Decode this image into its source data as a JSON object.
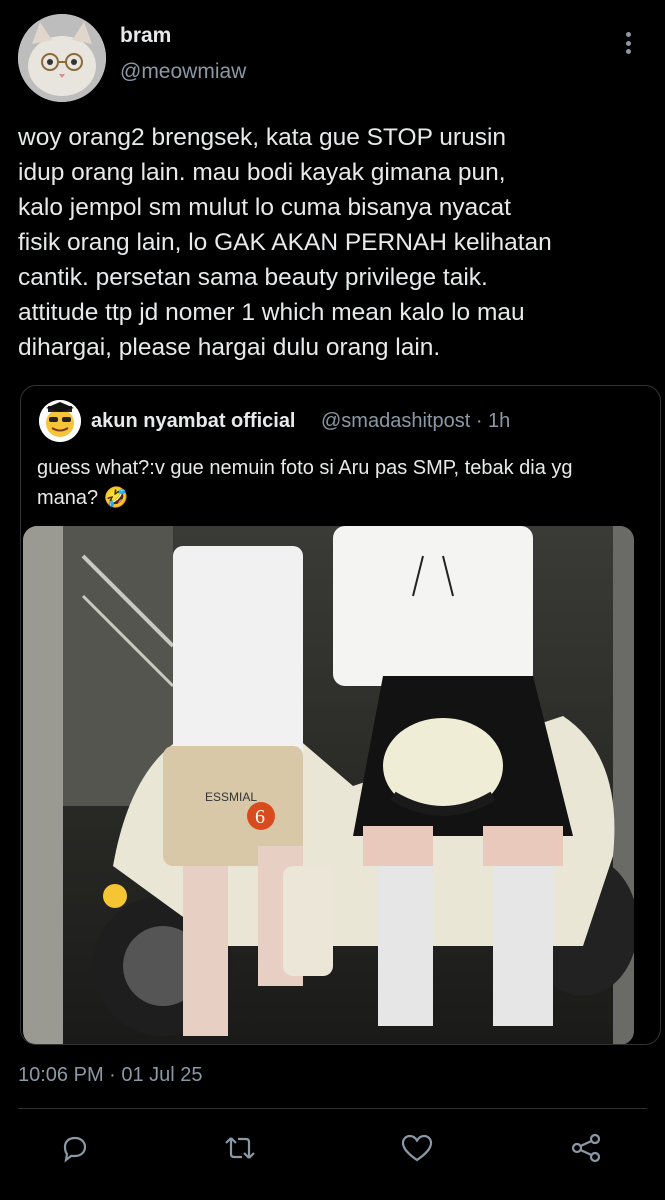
{
  "author": {
    "name": "bram",
    "handle": "@meowmiaw"
  },
  "tweet": {
    "text": "woy orang2 brengsek, kata gue STOP urusin\nidup orang lain. mau bodi kayak gimana pun,\nkalo jempol sm mulut lo cuma bisanya nyacat\nfisik orang lain, lo GAK AKAN PERNAH kelihatan\ncantik. persetan sama beauty privilege taik.\nattitude ttp jd nomer 1 which mean kalo lo mau\ndihargai, please hargai dulu orang lain.",
    "timestamp": "10:06 PM · 01 Jul 25"
  },
  "quoted": {
    "name": "akun nyambat official",
    "meta": "@smadashitpost · 1h",
    "text": "guess what?:v gue nemuin foto si Aru pas SMP, tebak dia yg mana? 🤣",
    "photo_text": {
      "shorts_print": "ESSMIAL",
      "sticker_number": "6"
    }
  },
  "icons": {
    "more": "more-vertical-icon",
    "reply": "reply-icon",
    "retweet": "retweet-icon",
    "like": "like-icon",
    "share": "share-icon"
  },
  "colors": {
    "background": "#000000",
    "text": "#e7e9ea",
    "secondary": "#8b98a5",
    "border": "#2f3336"
  }
}
